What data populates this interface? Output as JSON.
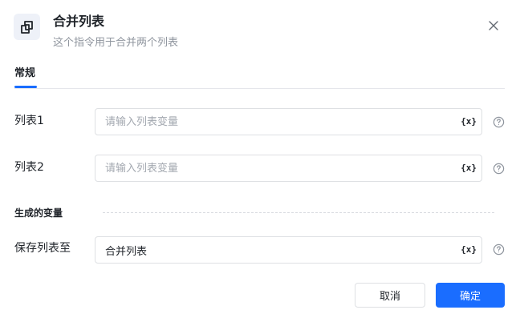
{
  "header": {
    "title": "合并列表",
    "subtitle": "这个指令用于合并两个列表"
  },
  "tabs": [
    {
      "label": "常规",
      "active": true
    }
  ],
  "fields": [
    {
      "label": "列表1",
      "value": "",
      "placeholder": "请输入列表变量",
      "var_label": "{x}"
    },
    {
      "label": "列表2",
      "value": "",
      "placeholder": "请输入列表变量",
      "var_label": "{x}"
    }
  ],
  "output_section": {
    "title": "生成的变量",
    "fields": [
      {
        "label": "保存列表至",
        "value": "合并列表",
        "placeholder": "",
        "var_label": "{x}"
      }
    ]
  },
  "footer": {
    "cancel_label": "取消",
    "ok_label": "确定"
  },
  "colors": {
    "primary": "#1a6dff",
    "text": "#1f2329",
    "muted": "#8f959e",
    "border": "#dee0e3"
  }
}
